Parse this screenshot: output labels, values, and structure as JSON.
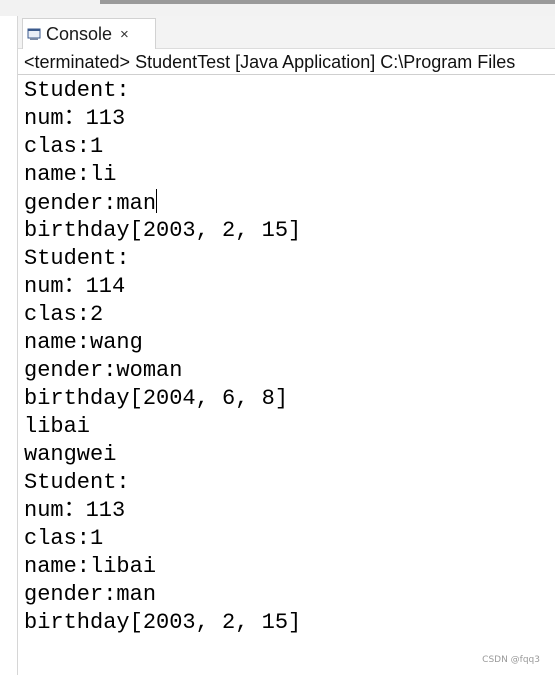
{
  "console_tab": {
    "label": "Console",
    "close_glyph": "×",
    "icon": "console-icon"
  },
  "status": "<terminated> StudentTest [Java Application] C:\\Program Files",
  "output_lines": [
    "Student:",
    "num：113",
    "clas:1",
    "name:li",
    "gender:man",
    "birthday[2003, 2, 15]",
    "Student:",
    "num：114",
    "clas:2",
    "name:wang",
    "gender:woman",
    "birthday[2004, 6, 8]",
    "libai",
    "wangwei",
    "Student:",
    "num：113",
    "clas:1",
    "name:libai",
    "gender:man",
    "birthday[2003, 2, 15]"
  ],
  "caret_line_index": 4,
  "watermark": "CSDN @fqq3"
}
